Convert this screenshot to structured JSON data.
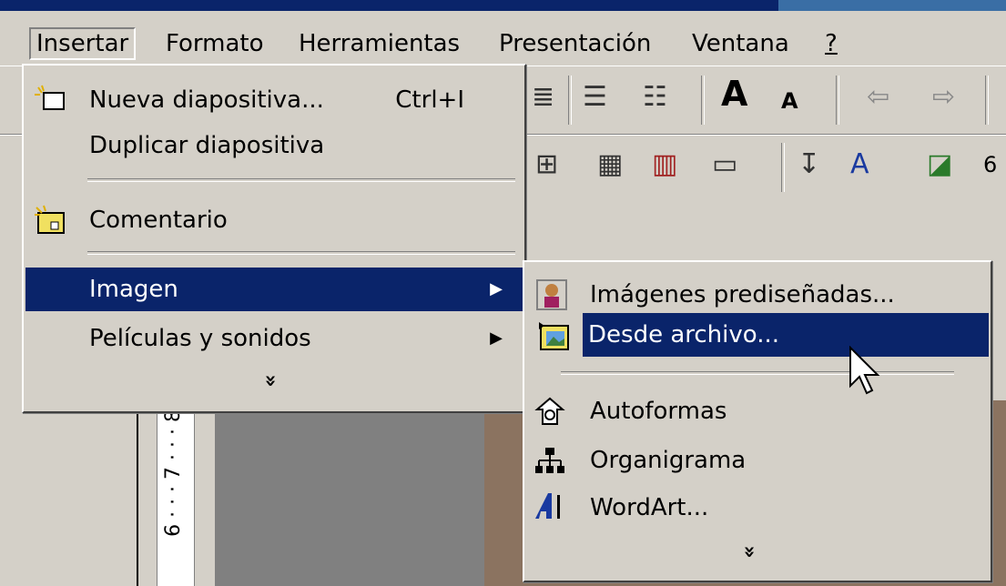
{
  "menubar": {
    "items": [
      {
        "label": "Insertar"
      },
      {
        "label": "Formato"
      },
      {
        "label": "Herramientas"
      },
      {
        "label": "Presentación"
      },
      {
        "label": "Ventana"
      },
      {
        "label": "?"
      }
    ]
  },
  "toolbar": {
    "partial_number": "6"
  },
  "ruler": {
    "marks": "6 · · · 7 · · · 8"
  },
  "insert_menu": {
    "items": [
      {
        "label": "Nueva diapositiva...",
        "shortcut": "Ctrl+I",
        "icon": "new-slide-icon"
      },
      {
        "label": "Duplicar diapositiva"
      },
      {
        "label": "Comentario",
        "icon": "comment-icon"
      },
      {
        "label": "Imagen",
        "submenu": true,
        "highlighted": true
      },
      {
        "label": "Películas y sonidos",
        "submenu": true
      }
    ],
    "expand": "»"
  },
  "image_submenu": {
    "items": [
      {
        "label": "Imágenes prediseñadas...",
        "icon": "clipart-icon"
      },
      {
        "label": "Desde archivo...",
        "icon": "picture-from-file-icon",
        "highlighted": true
      },
      {
        "label": "Autoformas",
        "icon": "autoshapes-icon"
      },
      {
        "label": "Organigrama",
        "icon": "org-chart-icon"
      },
      {
        "label": "WordArt...",
        "icon": "wordart-icon"
      }
    ],
    "expand": "»"
  },
  "colors": {
    "highlight": "#0a246a",
    "face": "#d4d0c8",
    "brown": "#8b7360"
  }
}
